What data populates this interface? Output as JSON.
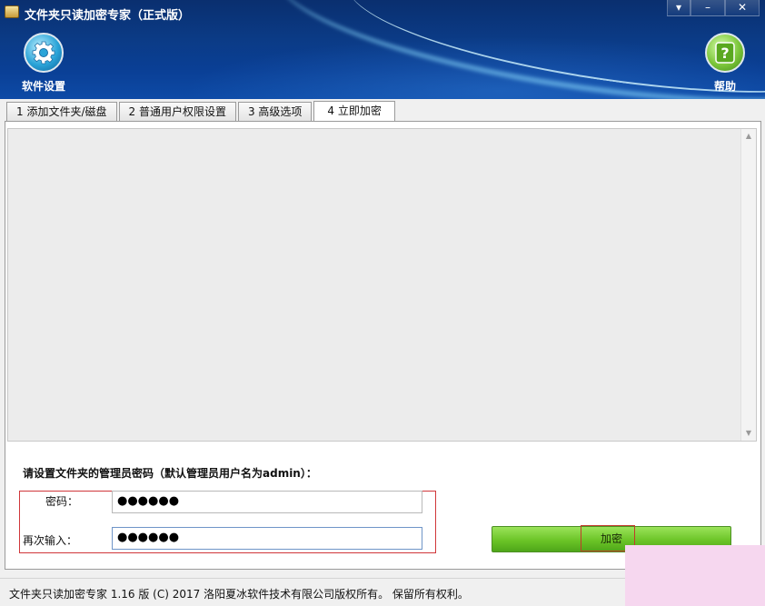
{
  "window": {
    "title": "文件夹只读加密专家（正式版）",
    "controls": [
      "▾",
      "–",
      "✕"
    ]
  },
  "toolbar": {
    "settings_label": "软件设置",
    "help_label": "帮助"
  },
  "tabs": [
    {
      "label": "1 添加文件夹/磁盘",
      "active": false
    },
    {
      "label": "2 普通用户权限设置",
      "active": false
    },
    {
      "label": "3 高级选项",
      "active": false
    },
    {
      "label": "4 立即加密",
      "active": true
    }
  ],
  "form": {
    "prompt": "请设置文件夹的管理员密码（默认管理员用户名为admin）：",
    "password_label": "密码：",
    "password_value": "●●●●●●",
    "repeat_label": "再次输入：",
    "repeat_value": "●●●●●●",
    "encrypt_label": "加密"
  },
  "status": {
    "text": "文件夹只读加密专家 1.16 版 (C) 2017 洛阳夏冰软件技术有限公司版权所有。 保留所有权利。"
  },
  "colors": {
    "header_bg": "#0b3b86",
    "encrypt_button": "#6bc427",
    "highlight_box": "#d0373a"
  }
}
